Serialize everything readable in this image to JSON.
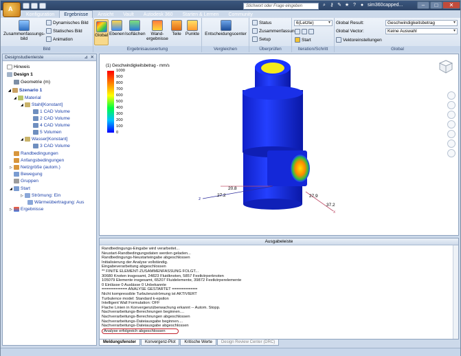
{
  "app": {
    "logo_letter": "A"
  },
  "menu_tabs": [
    "Konfiguration",
    "Ergebnisse",
    "Ansicht",
    "Vault",
    "Autodesk 360",
    "Starten & Lernen",
    "Community"
  ],
  "search": {
    "placeholder": "Stichwort oder Frage eingeben"
  },
  "user": {
    "name": "sim360capped..."
  },
  "ribbon": {
    "bild": {
      "label": "Bild",
      "big_button": "Zusammenfassungs-bild",
      "small": [
        "Dynamisches Bild",
        "Statisches Bild",
        "Animation"
      ]
    },
    "auswertung": {
      "label": "Ergebnisauswertung",
      "buttons": [
        "Global",
        "Ebenen",
        "Isoflächen",
        "Wand-ergebnisse",
        "Teile",
        "Punkte"
      ]
    },
    "vergleichen": {
      "label": "Vergleichen",
      "button": "Entscheidungscenter"
    },
    "ueberpruefen": {
      "label": "Überprüfen",
      "small": [
        "Status",
        "Zusammenfassung",
        "Setup"
      ]
    },
    "iteration": {
      "label": "Iteration/Schritt",
      "dropdown": "6(Letzte)",
      "start": "Start"
    },
    "global": {
      "label": "Global",
      "result_label": "Global Result:",
      "result_value": "Geschwindigkeitsbetrag",
      "vector_label": "Global Vector:",
      "vector_value": "Keine Auswahl",
      "settings": "Vektoreinstellungen"
    }
  },
  "panel": {
    "title": "Designstudienleiste",
    "tree": [
      {
        "label": "Hinweis",
        "style": "blk"
      },
      {
        "label": "Design 1",
        "style": "b"
      },
      {
        "label": "Geometrie (m)",
        "style": "blk"
      },
      {
        "label": "Szenario 1",
        "style": "b"
      },
      {
        "label": "Material",
        "style": ""
      },
      {
        "label": "Stahl[Konstant]",
        "style": ""
      },
      {
        "label": "1 CAD Volume",
        "style": ""
      },
      {
        "label": "2 CAD Volume",
        "style": ""
      },
      {
        "label": "4 CAD Volume",
        "style": ""
      },
      {
        "label": "5 Volumen",
        "style": ""
      },
      {
        "label": "Wasser[Konstant]",
        "style": ""
      },
      {
        "label": "3 CAD Volume",
        "style": ""
      },
      {
        "label": "Randbedingungen",
        "style": ""
      },
      {
        "label": "Anfangsbedingungen",
        "style": ""
      },
      {
        "label": "Netzgröße (autom.)",
        "style": ""
      },
      {
        "label": "Bewegung",
        "style": ""
      },
      {
        "label": "Gruppen",
        "style": ""
      },
      {
        "label": "Start",
        "style": ""
      },
      {
        "label": "Strömung: Ein",
        "style": ""
      },
      {
        "label": "Wärmeübertragung: Aus",
        "style": ""
      },
      {
        "label": "Ergebnisse",
        "style": ""
      }
    ]
  },
  "viewport": {
    "legend_title": "(1) Geschwindigkeitsbetrag - mm/s",
    "legend_ticks": [
      "1000",
      "950",
      "900",
      "850",
      "800",
      "750",
      "700",
      "650",
      "600",
      "550",
      "500",
      "450",
      "400",
      "350",
      "300",
      "250",
      "200",
      "150",
      "100",
      "50",
      "0"
    ],
    "labels": [
      "20.8",
      "27.2",
      "27.9",
      "37.2",
      "z",
      "x"
    ]
  },
  "output": {
    "title": "Ausgabeleiste",
    "lines": [
      "Randbedingungs-Eingabe wird verarbeitet...",
      "Neustart-Randbedingungsdaten werden geladen...",
      "Randbedingungs-Neustarteingabe abgeschlossen",
      "Initialisierung der Analyse vollständig.",
      "Eingabeverarbeitung abgeschlossen",
      "** FINITE ELEMENT-ZUSAMMENFASSUNG FOLGT...",
      "30680 Knoten insgesamt,    24823 Fluidknoten,    5857 Festkörperknoten",
      "105079 Elemente insgesamt,   65207 Fluidelemente,    39872 Festkörperelemente",
      "0 Einlässe    0 Auslässe    0 Unbekannte",
      "=========== ANALYSE GESTARTET ===========",
      "Nicht kompressible Turbulenzströmung ist AKTIVIERT",
      "Turbulence model: Standard k-epsilon",
      "Intelligent Wall Formulation: OFF",
      "Flache Linien in Konvergenzüberwachung erkannt -- Autom. Stopp.",
      "Nachverarbeitungs-Berechnungen beginnen....",
      "Nachverarbeitungs-Berechnungen abgeschlossen",
      "Nachverarbeitungs-Dateiausgabe beginnen....",
      "Nachverarbeitungs-Dateiausgabe abgeschlossen",
      "Analyse erfolgreich abgeschlossen"
    ]
  },
  "bottom_tabs": [
    "Meldungsfenster",
    "Konvergenz-Plot",
    "Kritische Werte",
    "Design Review Center (DRC)"
  ]
}
